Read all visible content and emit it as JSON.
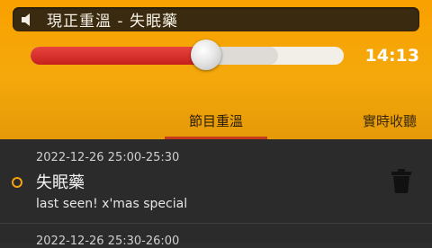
{
  "now_playing": {
    "text": "現正重溫 - 失眠藥"
  },
  "player": {
    "elapsed": "14:13",
    "progress": 0.56,
    "buffered": 0.79
  },
  "tabs": [
    {
      "label": "節目重溫",
      "active": true
    },
    {
      "label": "實時收聽",
      "active": false
    }
  ],
  "episodes": [
    {
      "datetime": "2022-12-26  25:00-25:30",
      "title": "失眠藥",
      "subtitle": "last seen! x'mas special"
    },
    {
      "datetime": "2022-12-26  25:30-26:00"
    }
  ],
  "colors": {
    "accent": "#f4a10c",
    "progress": "#d12b26",
    "tab_underline": "#c43a1a"
  },
  "icons": {
    "speaker": "speaker-icon",
    "trash": "trash-icon",
    "bullet": "current-item-dot-icon"
  }
}
